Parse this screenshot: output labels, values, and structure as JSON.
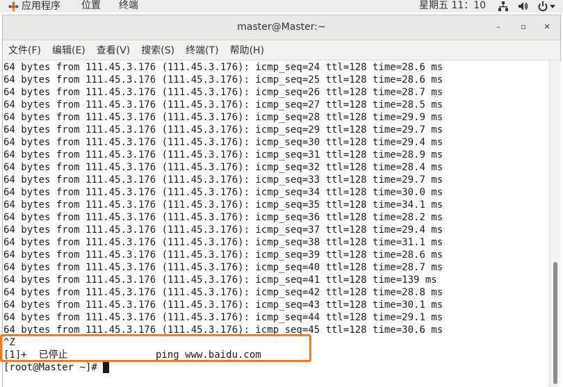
{
  "topbar": {
    "apps_label": "应用程序",
    "places_label": "位置",
    "terminal_label": "终端",
    "clock": "星期五 11：10"
  },
  "window": {
    "title": "master@Master:~",
    "minimize": "–",
    "maximize": "▫",
    "close": "✕"
  },
  "menubar": {
    "items": [
      "文件(F)",
      "编辑(E)",
      "查看(V)",
      "搜索(S)",
      "终端(T)",
      "帮助(H)"
    ]
  },
  "terminal": {
    "lines": [
      "64 bytes from 111.45.3.176 (111.45.3.176): icmp_seq=24 ttl=128 time=28.6 ms",
      "64 bytes from 111.45.3.176 (111.45.3.176): icmp_seq=25 ttl=128 time=28.6 ms",
      "64 bytes from 111.45.3.176 (111.45.3.176): icmp_seq=26 ttl=128 time=28.7 ms",
      "64 bytes from 111.45.3.176 (111.45.3.176): icmp_seq=27 ttl=128 time=28.5 ms",
      "64 bytes from 111.45.3.176 (111.45.3.176): icmp_seq=28 ttl=128 time=29.9 ms",
      "64 bytes from 111.45.3.176 (111.45.3.176): icmp_seq=29 ttl=128 time=29.7 ms",
      "64 bytes from 111.45.3.176 (111.45.3.176): icmp_seq=30 ttl=128 time=29.4 ms",
      "64 bytes from 111.45.3.176 (111.45.3.176): icmp_seq=31 ttl=128 time=28.9 ms",
      "64 bytes from 111.45.3.176 (111.45.3.176): icmp_seq=32 ttl=128 time=28.4 ms",
      "64 bytes from 111.45.3.176 (111.45.3.176): icmp_seq=33 ttl=128 time=29.7 ms",
      "64 bytes from 111.45.3.176 (111.45.3.176): icmp_seq=34 ttl=128 time=30.0 ms",
      "64 bytes from 111.45.3.176 (111.45.3.176): icmp_seq=35 ttl=128 time=34.1 ms",
      "64 bytes from 111.45.3.176 (111.45.3.176): icmp_seq=36 ttl=128 time=28.2 ms",
      "64 bytes from 111.45.3.176 (111.45.3.176): icmp_seq=37 ttl=128 time=29.4 ms",
      "64 bytes from 111.45.3.176 (111.45.3.176): icmp_seq=38 ttl=128 time=31.1 ms",
      "64 bytes from 111.45.3.176 (111.45.3.176): icmp_seq=39 ttl=128 time=28.6 ms",
      "64 bytes from 111.45.3.176 (111.45.3.176): icmp_seq=40 ttl=128 time=28.7 ms",
      "64 bytes from 111.45.3.176 (111.45.3.176): icmp_seq=41 ttl=128 time=139 ms",
      "64 bytes from 111.45.3.176 (111.45.3.176): icmp_seq=42 ttl=128 time=28.8 ms",
      "64 bytes from 111.45.3.176 (111.45.3.176): icmp_seq=43 ttl=128 time=30.1 ms",
      "64 bytes from 111.45.3.176 (111.45.3.176): icmp_seq=44 ttl=128 time=29.1 ms",
      "64 bytes from 111.45.3.176 (111.45.3.176): icmp_seq=45 ttl=128 time=30.6 ms",
      "^Z",
      "[1]+  已停止               ping www.baidu.com"
    ],
    "prompt": "[root@Master ~]# "
  },
  "colors": {
    "highlight": "#f07d1a",
    "terminal_bg": "#ffffff",
    "terminal_fg": "#1a1a1a"
  },
  "icons": [
    "apps-icon",
    "network-icon",
    "volume-icon",
    "power-icon",
    "minimize-icon",
    "maximize-icon",
    "close-icon"
  ]
}
